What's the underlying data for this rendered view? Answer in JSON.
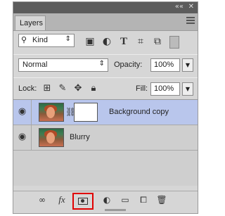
{
  "panel": {
    "tab_label": "Layers",
    "collapse_glyph": "««",
    "close_glyph": "✕"
  },
  "filter": {
    "kind_label": "Kind",
    "icons": [
      "image-icon",
      "adjustment-icon",
      "type-icon",
      "shape-icon",
      "smart-object-icon",
      "filter-toggle-icon"
    ]
  },
  "blend": {
    "mode": "Normal",
    "opacity_label": "Opacity:",
    "opacity_value": "100%"
  },
  "lock": {
    "label": "Lock:",
    "fill_label": "Fill:",
    "fill_value": "100%"
  },
  "layers": [
    {
      "name": "Background copy",
      "selected": true,
      "has_mask": true
    },
    {
      "name": "Blurry",
      "selected": false,
      "has_mask": false
    }
  ],
  "bottom_icons": [
    "link-layers-icon",
    "fx-icon",
    "add-mask-icon",
    "adjustment-layer-icon",
    "group-icon",
    "new-layer-icon",
    "trash-icon"
  ],
  "colors": {
    "selected_layer": "#b9c6ec",
    "highlight": "#e00000"
  }
}
